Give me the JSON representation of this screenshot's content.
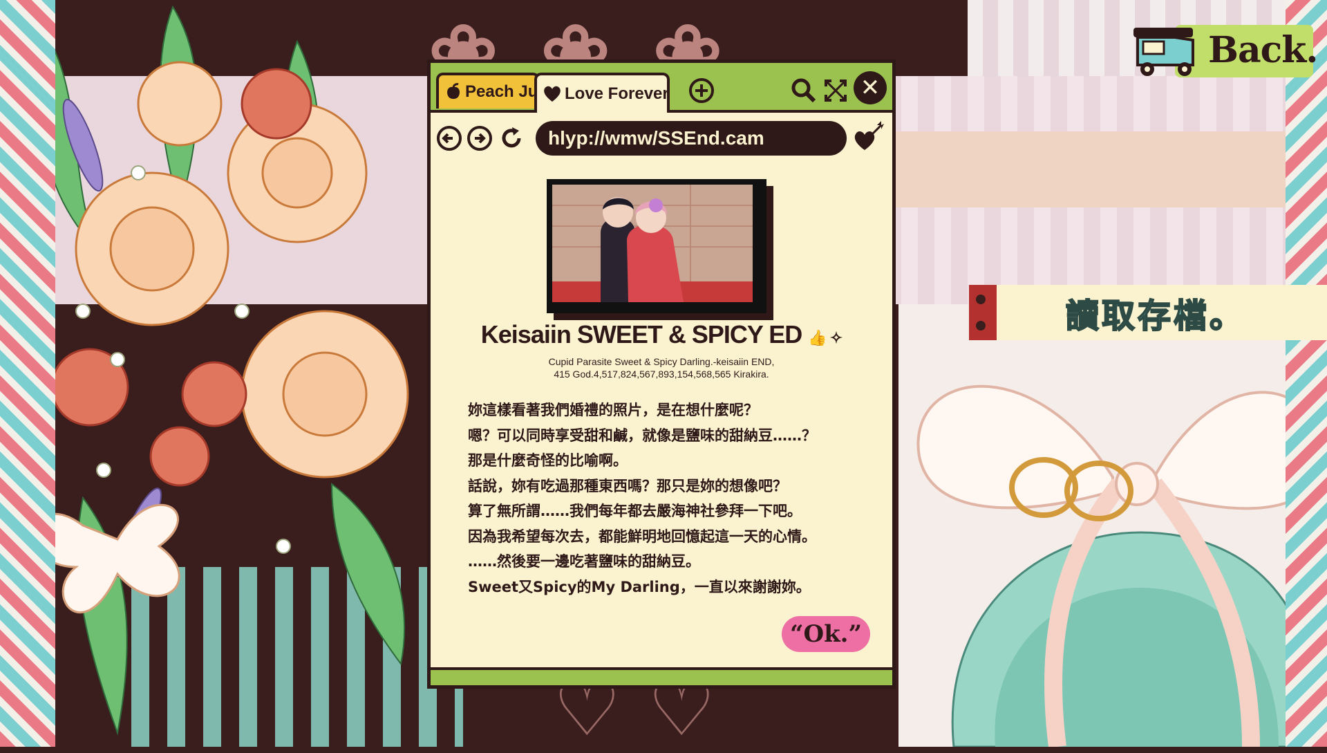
{
  "back_button": {
    "label": "Back."
  },
  "load_banner": {
    "label": "讀取存檔。"
  },
  "browser": {
    "tabs": [
      {
        "label": "Peach Juice"
      },
      {
        "label": "Love Forever"
      }
    ],
    "url": "hlyp://wmw/SSEnd.cam",
    "ending": {
      "title": "Keisaiin SWEET & SPICY ED",
      "title_extras": "👍 ✧",
      "meta_line1": "Cupid Parasite Sweet & Spicy Darling.-keisaiin END,",
      "meta_line2": "415 God.4,517,824,567,893,154,568,565 Kirakira."
    },
    "message_lines": [
      "妳這樣看著我們婚禮的照片，是在想什麼呢？",
      "嗯？可以同時享受甜和鹹，就像是鹽味的甜納豆……？",
      "那是什麼奇怪的比喻啊。",
      "話說，妳有吃過那種東西嗎？那只是妳的想像吧？",
      "算了無所謂……我們每年都去嚴海神社參拜一下吧。",
      "因為我希望每次去，都能鮮明地回憶起這一天的心情。",
      "……然後要一邊吃著鹽味的甜納豆。",
      "Sweet又Spicy的My Darling，一直以來謝謝妳。"
    ],
    "ok_label": "“Ok.”"
  },
  "colors": {
    "accent_green": "#9bc14f",
    "paper": "#fbf3cf",
    "ink": "#2e1818",
    "ok_pink": "#ee6fa3",
    "tab_yellow": "#f2c13a"
  }
}
